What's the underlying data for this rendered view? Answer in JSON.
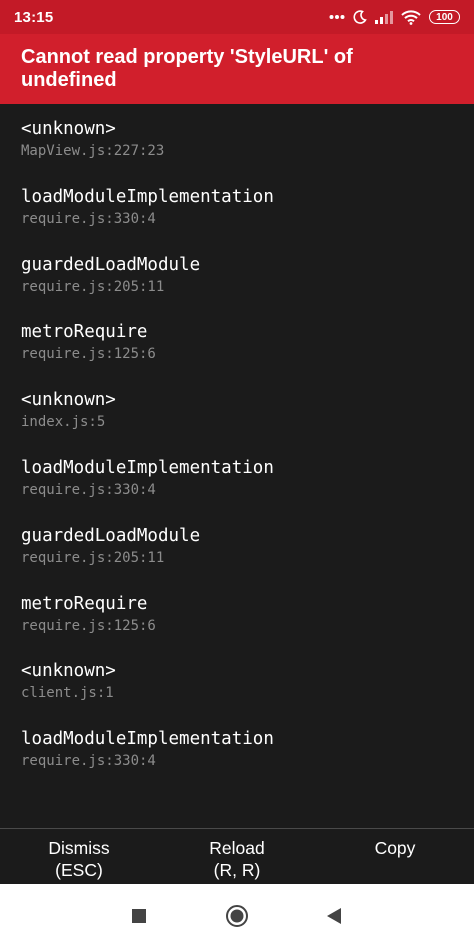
{
  "status_bar": {
    "time": "13:15",
    "battery": "100",
    "icons": [
      "more-dots-icon",
      "moon-icon",
      "signal-icon",
      "wifi-icon",
      "battery-icon"
    ]
  },
  "error": {
    "message": "Cannot read property 'StyleURL' of undefined"
  },
  "stack_frames": [
    {
      "method": "<unknown>",
      "file": "MapView.js:227:23"
    },
    {
      "method": "loadModuleImplementation",
      "file": "require.js:330:4"
    },
    {
      "method": "guardedLoadModule",
      "file": "require.js:205:11"
    },
    {
      "method": "metroRequire",
      "file": "require.js:125:6"
    },
    {
      "method": "<unknown>",
      "file": "index.js:5"
    },
    {
      "method": "loadModuleImplementation",
      "file": "require.js:330:4"
    },
    {
      "method": "guardedLoadModule",
      "file": "require.js:205:11"
    },
    {
      "method": "metroRequire",
      "file": "require.js:125:6"
    },
    {
      "method": "<unknown>",
      "file": "client.js:1"
    },
    {
      "method": "loadModuleImplementation",
      "file": "require.js:330:4"
    }
  ],
  "actions": {
    "dismiss": {
      "line1": "Dismiss",
      "line2": "(ESC)"
    },
    "reload": {
      "line1": "Reload",
      "line2": "(R, R)"
    },
    "copy": {
      "line1": "Copy"
    }
  },
  "nav_bar": {
    "icons": [
      "recents-square-icon",
      "home-circle-icon",
      "back-triangle-icon"
    ]
  },
  "colors": {
    "status_bar": "#c31a27",
    "error_header": "#d11f2c",
    "background": "#1b1b1b",
    "method_text": "#ffffff",
    "file_text": "#8c8c8c",
    "divider": "#4a4a4a"
  }
}
